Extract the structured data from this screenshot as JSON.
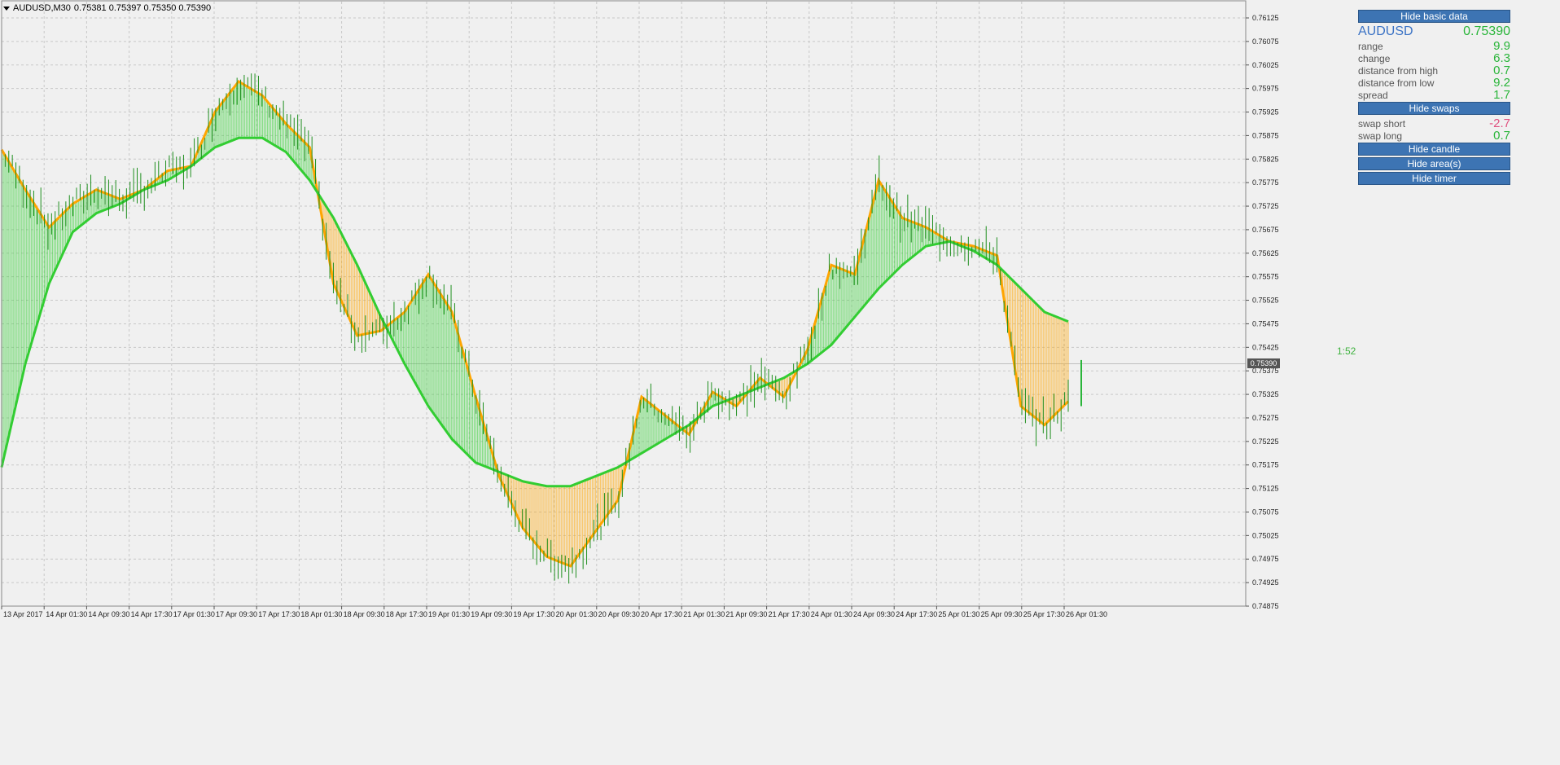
{
  "header": {
    "symbol_timeframe": "AUDUSD,M30",
    "ohlc": "0.75381 0.75397 0.75350 0.75390"
  },
  "panel": {
    "hide_basic_data": "Hide basic data",
    "symbol": "AUDUSD",
    "price": "0.75390",
    "rows": [
      {
        "label": "range",
        "value": "9.9"
      },
      {
        "label": "change",
        "value": "6.3"
      },
      {
        "label": "distance from high",
        "value": "0.7"
      },
      {
        "label": "distance from low",
        "value": "9.2"
      },
      {
        "label": "spread",
        "value": "1.7"
      }
    ],
    "hide_swaps": "Hide swaps",
    "swaps": [
      {
        "label": "swap short",
        "value": "-2.7"
      },
      {
        "label": "swap long",
        "value": "0.7"
      }
    ],
    "hide_candle": "Hide candle",
    "hide_areas": "Hide area(s)",
    "hide_timer": "Hide timer"
  },
  "timer": "1:52",
  "current_price_label": "0.75390",
  "colors": {
    "bull": "#32cd32",
    "bear": "#ffa500",
    "button": "#3d74b3",
    "accent": "#3b73c5",
    "negative": "#e0507f"
  },
  "chart_data": {
    "type": "line",
    "y_ticks": [
      "0.76125",
      "0.76075",
      "0.76025",
      "0.75975",
      "0.75925",
      "0.75875",
      "0.75825",
      "0.75775",
      "0.75725",
      "0.75675",
      "0.75625",
      "0.75575",
      "0.75525",
      "0.75475",
      "0.75425",
      "0.75390",
      "0.75375",
      "0.75325",
      "0.75275",
      "0.75225",
      "0.75175",
      "0.75125",
      "0.75075",
      "0.75025",
      "0.74975",
      "0.74925",
      "0.74875"
    ],
    "x_ticks": [
      "13 Apr 2017",
      "14 Apr 01:30",
      "14 Apr 09:30",
      "14 Apr 17:30",
      "17 Apr 01:30",
      "17 Apr 09:30",
      "17 Apr 17:30",
      "18 Apr 01:30",
      "18 Apr 09:30",
      "18 Apr 17:30",
      "19 Apr 01:30",
      "19 Apr 09:30",
      "19 Apr 17:30",
      "20 Apr 01:30",
      "20 Apr 09:30",
      "20 Apr 17:30",
      "21 Apr 01:30",
      "21 Apr 09:30",
      "21 Apr 17:30",
      "24 Apr 01:30",
      "24 Apr 09:30",
      "24 Apr 17:30",
      "25 Apr 01:30",
      "25 Apr 09:30",
      "25 Apr 17:30",
      "26 Apr 01:30"
    ],
    "ylim": [
      0.74875,
      0.76125
    ],
    "fast_ma": [
      0.75845,
      0.7576,
      0.7568,
      0.7573,
      0.7576,
      0.7574,
      0.7576,
      0.758,
      0.7581,
      0.75925,
      0.7599,
      0.7596,
      0.759,
      0.7585,
      0.7556,
      0.7545,
      0.7546,
      0.755,
      0.7558,
      0.755,
      0.7532,
      0.7515,
      0.7504,
      0.7498,
      0.7496,
      0.7503,
      0.751,
      0.7532,
      0.7528,
      0.7524,
      0.7533,
      0.753,
      0.7536,
      0.7532,
      0.7542,
      0.756,
      0.7558,
      0.7578,
      0.757,
      0.7568,
      0.7565,
      0.7564,
      0.7562,
      0.753,
      0.7526,
      0.7531
    ],
    "slow_ma": [
      0.7517,
      0.7539,
      0.7556,
      0.7567,
      0.7571,
      0.7573,
      0.7576,
      0.7578,
      0.7581,
      0.7585,
      0.7587,
      0.7587,
      0.7584,
      0.7578,
      0.757,
      0.756,
      0.7549,
      0.7539,
      0.753,
      0.7523,
      0.7518,
      0.7516,
      0.7514,
      0.7513,
      0.7513,
      0.7515,
      0.7517,
      0.752,
      0.7523,
      0.7526,
      0.753,
      0.7532,
      0.7534,
      0.7536,
      0.7539,
      0.7543,
      0.7549,
      0.7555,
      0.756,
      0.7564,
      0.7565,
      0.7563,
      0.756,
      0.7555,
      0.755,
      0.7548
    ]
  }
}
